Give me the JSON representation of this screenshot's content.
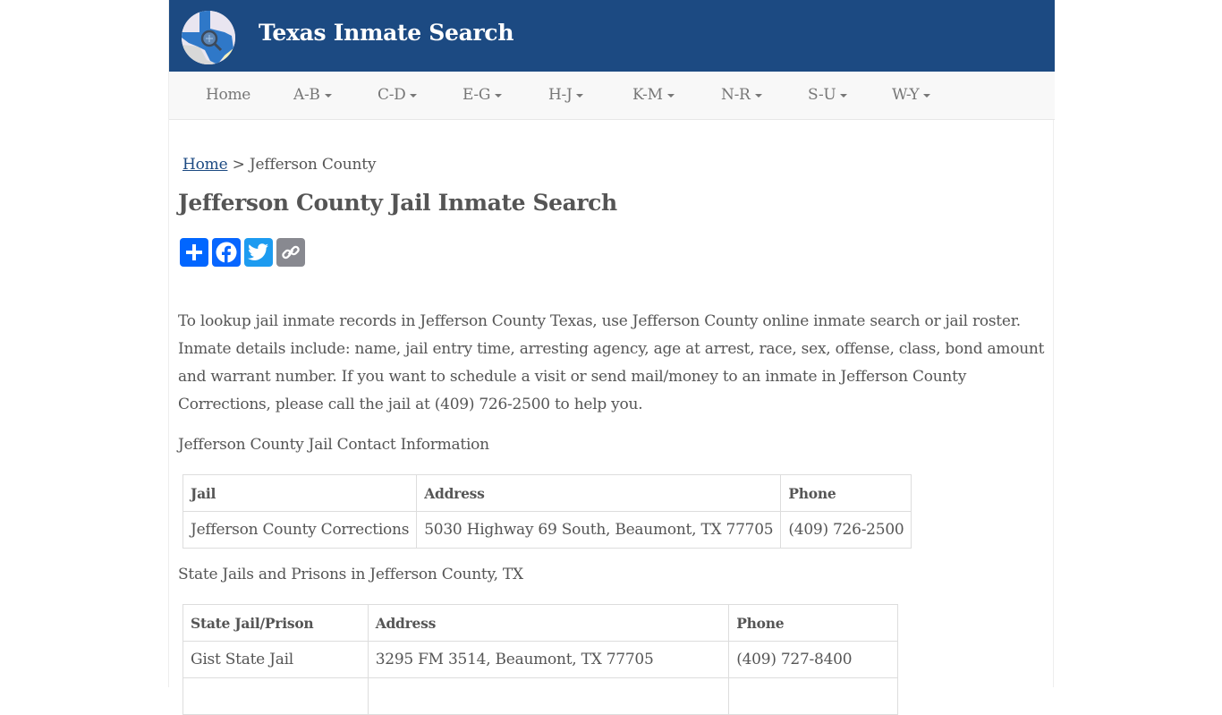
{
  "header": {
    "site_title": "Texas Inmate Search",
    "logo_icon": "texas-map-magnifier-logo",
    "colors": {
      "header_bg": "#1c4a82",
      "nav_bg": "#f8f8f8",
      "text": "#555555",
      "link": "#1c4a82"
    }
  },
  "nav": {
    "items": [
      {
        "label": "Home",
        "dropdown": false
      },
      {
        "label": "A-B",
        "dropdown": true
      },
      {
        "label": "C-D",
        "dropdown": true
      },
      {
        "label": "E-G",
        "dropdown": true
      },
      {
        "label": "H-J",
        "dropdown": true
      },
      {
        "label": "K-M",
        "dropdown": true
      },
      {
        "label": "N-R",
        "dropdown": true
      },
      {
        "label": "S-U",
        "dropdown": true
      },
      {
        "label": "W-Y",
        "dropdown": true
      }
    ]
  },
  "breadcrumb": {
    "home": "Home",
    "separator": " > ",
    "current": "Jefferson County"
  },
  "page_title": "Jefferson County Jail Inmate Search",
  "share": {
    "buttons": [
      {
        "name": "share",
        "icon": "plus-icon",
        "color": "#0166ff"
      },
      {
        "name": "facebook",
        "icon": "facebook-icon",
        "color": "#0866ff"
      },
      {
        "name": "twitter",
        "icon": "twitter-icon",
        "color": "#1d9bf0"
      },
      {
        "name": "copy-link",
        "icon": "link-icon",
        "color": "#888990"
      }
    ]
  },
  "intro": "To lookup jail inmate records in Jefferson County Texas, use Jefferson County online inmate search or jail roster. Inmate details include: name, jail entry time, arresting agency, age at arrest, race, sex, offense, class, bond amount and warrant number. If you want to schedule a visit or send mail/money to an inmate in Jefferson County Corrections, please call the jail at (409) 726-2500 to help you.",
  "contact": {
    "heading": "Jefferson County Jail Contact Information",
    "columns": [
      "Jail",
      "Address",
      "Phone"
    ],
    "rows": [
      [
        "Jefferson County Corrections",
        "5030 Highway 69 South, Beaumont, TX 77705",
        "(409) 726-2500"
      ]
    ]
  },
  "state": {
    "heading": "State Jails and Prisons in Jefferson County, TX",
    "columns": [
      "State Jail/Prison",
      "Address",
      "Phone"
    ],
    "rows": [
      [
        "Gist State Jail",
        "3295 FM 3514, Beaumont, TX 77705",
        "(409) 727-8400"
      ],
      [
        "",
        "",
        ""
      ]
    ]
  }
}
